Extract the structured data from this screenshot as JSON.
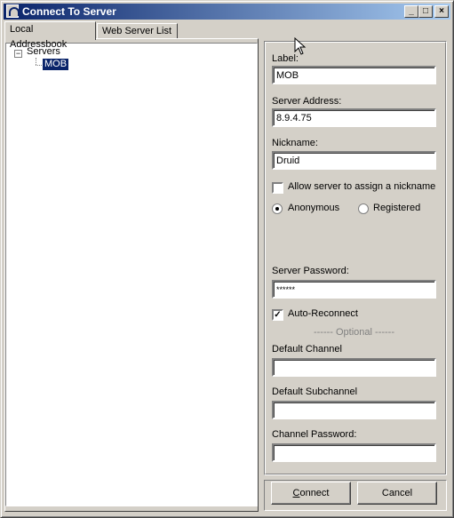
{
  "window": {
    "title": "Connect To Server"
  },
  "title_buttons": {
    "minimize": "_",
    "maximize": "□",
    "close": "×"
  },
  "tabs": [
    {
      "label": "Local Addressbook",
      "active": true
    },
    {
      "label": "Web Server List",
      "active": false
    }
  ],
  "tree": {
    "root_label": "Servers",
    "expander": "−",
    "items": [
      {
        "label": "MOB",
        "selected": true
      }
    ]
  },
  "form": {
    "label": {
      "label": "Label:",
      "value": "MOB"
    },
    "server_address": {
      "label": "Server Address:",
      "value": "8.9.4.75"
    },
    "nickname": {
      "label": "Nickname:",
      "value": "Druid"
    },
    "allow_assign": {
      "label": "Allow server to assign a nickname",
      "checked": false
    },
    "auth": {
      "anonymous": {
        "label": "Anonymous",
        "selected": true
      },
      "registered": {
        "label": "Registered",
        "selected": false
      }
    },
    "server_password": {
      "label": "Server Password:",
      "value": "******"
    },
    "auto_reconnect": {
      "label": "Auto-Reconnect",
      "checked": true,
      "mark": "✓"
    },
    "optional_separator": "------ Optional ------",
    "default_channel": {
      "label": "Default Channel",
      "value": ""
    },
    "default_subchannel": {
      "label": "Default Subchannel",
      "value": ""
    },
    "channel_password": {
      "label": "Channel Password:",
      "value": ""
    }
  },
  "buttons": {
    "connect": {
      "underline": "C",
      "rest": "onnect"
    },
    "cancel": {
      "label": "Cancel"
    }
  },
  "colors": {
    "titlebar_start": "#0a246a",
    "titlebar_end": "#a6caf0",
    "face": "#d4d0c8",
    "selection": "#0a246a"
  }
}
